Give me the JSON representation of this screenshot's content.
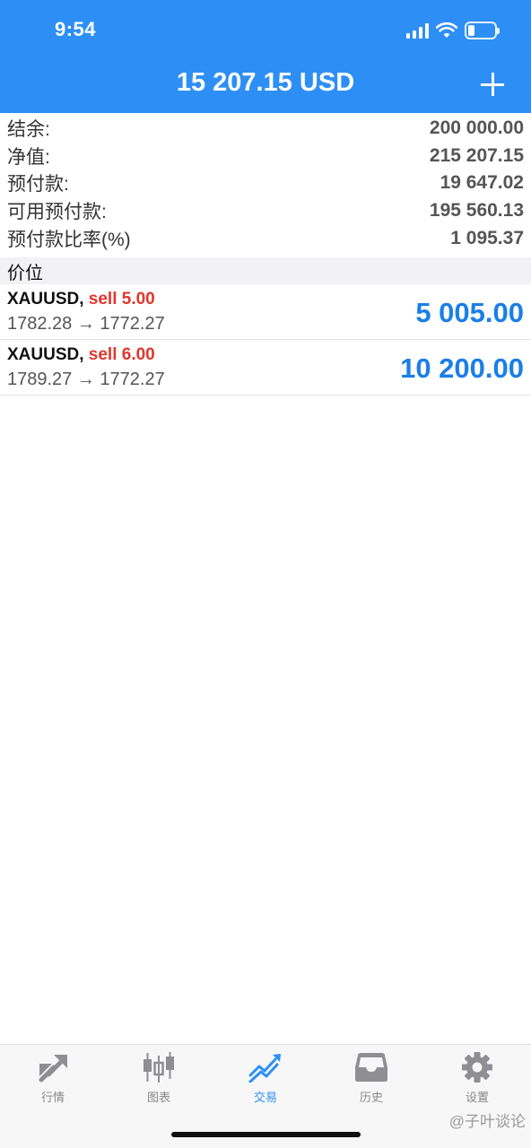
{
  "status_bar": {
    "time": "9:54",
    "battery_level": 0.25
  },
  "header": {
    "title": "15 207.15 USD",
    "add_icon": "plus-icon"
  },
  "summary": [
    {
      "label": "结余:",
      "value": "200 000.00"
    },
    {
      "label": "净值:",
      "value": "215 207.15"
    },
    {
      "label": "预付款:",
      "value": "19 647.02"
    },
    {
      "label": "可用预付款:",
      "value": "195 560.13"
    },
    {
      "label": "预付款比率(%)",
      "value": "1 095.37"
    }
  ],
  "section_title": "价位",
  "positions": [
    {
      "symbol": "XAUUSD,",
      "type": "sell 5.00",
      "prices": "1782.28 → 1772.27",
      "profit": "5 005.00"
    },
    {
      "symbol": "XAUUSD,",
      "type": "sell 6.00",
      "prices": "1789.27 → 1772.27",
      "profit": "10 200.00"
    }
  ],
  "tabs": [
    {
      "label": "行情",
      "icon": "quotes-arrows-icon",
      "active": false
    },
    {
      "label": "图表",
      "icon": "candlestick-chart-icon",
      "active": false
    },
    {
      "label": "交易",
      "icon": "trade-trend-icon",
      "active": true
    },
    {
      "label": "历史",
      "icon": "history-inbox-icon",
      "active": false
    },
    {
      "label": "设置",
      "icon": "settings-gear-icon",
      "active": false
    }
  ],
  "watermark": "@子叶谈论",
  "colors": {
    "accent": "#2d8ff5",
    "sell": "#e0362c",
    "profit": "#1a7fe8",
    "inactive_tab": "#8e8e93"
  }
}
